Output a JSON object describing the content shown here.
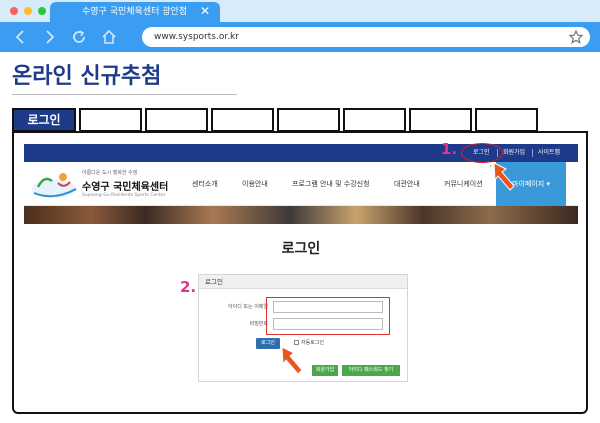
{
  "browser": {
    "tab_title": "수영구 국민체육센터 광안점",
    "close_glyph": "✕",
    "url": "www.sysports.or.kr"
  },
  "page": {
    "title": "온라인 신규추첨",
    "steps": [
      "로그인",
      "",
      "",
      "",
      "",
      "",
      "",
      ""
    ]
  },
  "site": {
    "top_nav": [
      "로그인",
      "회원가입",
      "사이트맵"
    ],
    "logo": {
      "tagline": "아름다운 도시 행복한 수영",
      "name": "수영구 국민체육센터",
      "english": "Suyeong-Gu Residents Sports Center"
    },
    "menu": [
      "센터소개",
      "이용안내",
      "프로그램 안내 및 수강신청",
      "대관안내",
      "커뮤니케이션"
    ],
    "my_page": "마이페이지 ▾",
    "login_heading": "로그인",
    "panel": {
      "title": "로그인",
      "id_label": "아이디 또는 이메일",
      "pw_label": "비밀번호",
      "login_button": "로그인",
      "remember_label": "자동로그인",
      "join_button": "회원가입",
      "find_button": "아이디 패스워드 찾기"
    }
  },
  "annotations": {
    "step1": "1.",
    "step2": "2.",
    "highlight_color": "#e02020",
    "arrow_color": "#e8551f",
    "number_color": "#e0348a"
  },
  "colors": {
    "browser_blue": "#3a9df2",
    "site_navy": "#1e3a8a",
    "mypage_blue": "#3a9ad9",
    "green_button": "#4aa84a"
  }
}
